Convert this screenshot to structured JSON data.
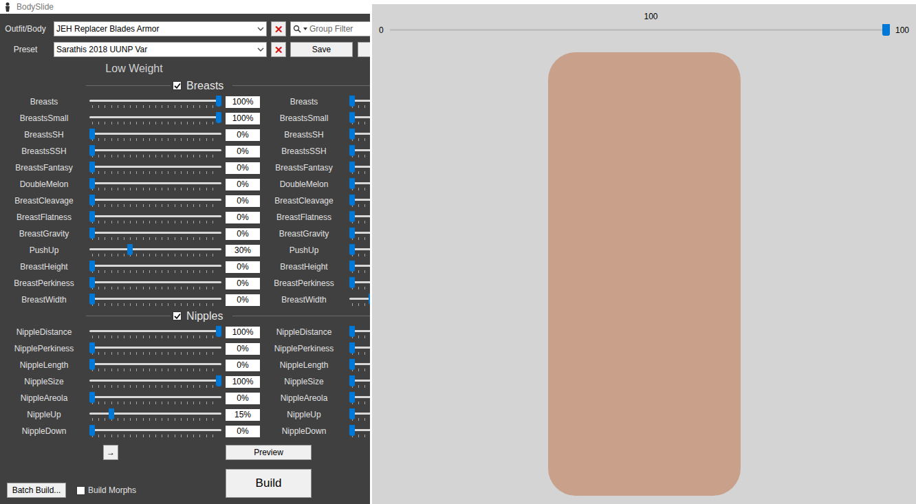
{
  "window": {
    "title": "BodySlide"
  },
  "outfit": {
    "label": "Outfit/Body",
    "value": "JEH Replacer Blades Armor",
    "clear": "✕"
  },
  "preset": {
    "label": "Preset",
    "value": "Sarathis 2018 UUNP Var",
    "clear": "✕"
  },
  "group_filter": {
    "placeholder": "Group Filter"
  },
  "save_button": "Save",
  "weight_label": "Low Weight",
  "sections": [
    {
      "title": "Breasts",
      "checked": true,
      "sliders": [
        {
          "name": "Breasts",
          "low": {
            "level": 1,
            "reading": "100%"
          },
          "high": {
            "level": 0
          }
        },
        {
          "name": "BreastsSmall",
          "low": {
            "level": 1,
            "reading": "100%"
          },
          "high": {
            "level": 0
          }
        },
        {
          "name": "BreastsSH",
          "low": {
            "level": 0,
            "reading": "0%"
          },
          "high": {
            "level": 0
          }
        },
        {
          "name": "BreastsSSH",
          "low": {
            "level": 0,
            "reading": "0%"
          },
          "high": {
            "level": 0
          }
        },
        {
          "name": "BreastsFantasy",
          "low": {
            "level": 0,
            "reading": "0%"
          },
          "high": {
            "level": 0
          }
        },
        {
          "name": "DoubleMelon",
          "low": {
            "level": 0,
            "reading": "0%"
          },
          "high": {
            "level": 0
          }
        },
        {
          "name": "BreastCleavage",
          "low": {
            "level": 0,
            "reading": "0%"
          },
          "high": {
            "level": 0
          }
        },
        {
          "name": "BreastFlatness",
          "low": {
            "level": 0,
            "reading": "0%"
          },
          "high": {
            "level": 0
          }
        },
        {
          "name": "BreastGravity",
          "low": {
            "level": 0,
            "reading": "0%"
          },
          "high": {
            "level": 0
          }
        },
        {
          "name": "PushUp",
          "low": {
            "level": 0.3,
            "reading": "30%"
          },
          "high": {
            "level": 0
          }
        },
        {
          "name": "BreastHeight",
          "low": {
            "level": 0,
            "reading": "0%"
          },
          "high": {
            "level": 0
          }
        },
        {
          "name": "BreastPerkiness",
          "low": {
            "level": 0,
            "reading": "0%"
          },
          "high": {
            "level": 0
          }
        },
        {
          "name": "BreastWidth",
          "low": {
            "level": 0,
            "reading": "0%"
          },
          "high": {
            "level": 0.15
          }
        }
      ]
    },
    {
      "title": "Nipples",
      "checked": true,
      "sliders": [
        {
          "name": "NippleDistance",
          "low": {
            "level": 1,
            "reading": "100%"
          },
          "high": {
            "level": 0
          }
        },
        {
          "name": "NipplePerkiness",
          "low": {
            "level": 0,
            "reading": "0%"
          },
          "high": {
            "level": 0
          }
        },
        {
          "name": "NippleLength",
          "low": {
            "level": 0,
            "reading": "0%"
          },
          "high": {
            "level": 0
          }
        },
        {
          "name": "NippleSize",
          "low": {
            "level": 1,
            "reading": "100%"
          },
          "high": {
            "level": 0
          }
        },
        {
          "name": "NippleAreola",
          "low": {
            "level": 0,
            "reading": "0%"
          },
          "high": {
            "level": 0
          }
        },
        {
          "name": "NippleUp",
          "low": {
            "level": 0.15,
            "reading": "15%"
          },
          "high": {
            "level": 0
          }
        },
        {
          "name": "NippleDown",
          "low": {
            "level": 0,
            "reading": "0%"
          },
          "high": {
            "level": 0
          }
        }
      ]
    }
  ],
  "arrow_button": "→",
  "preview_button": "Preview",
  "build_button": "Build",
  "batch_build_button": "Batch Build...",
  "build_morphs": {
    "label": "Build Morphs",
    "checked": false
  },
  "preview": {
    "value": "100",
    "min": "0",
    "max": "100",
    "level": 1
  }
}
